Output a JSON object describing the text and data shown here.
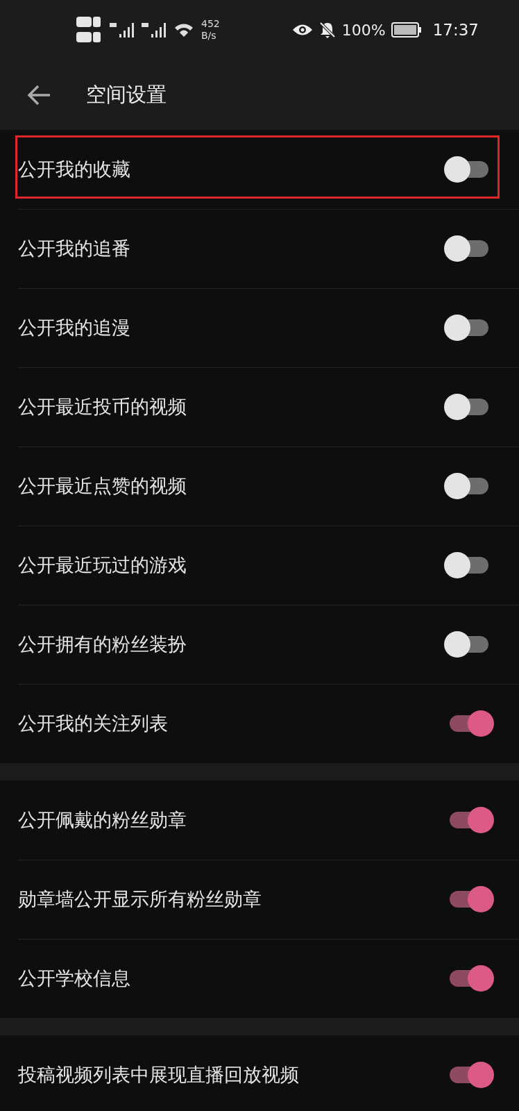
{
  "status_bar": {
    "network_speed": "452",
    "network_speed_unit": "B/s",
    "battery": "100%",
    "time": "17:37"
  },
  "header": {
    "title": "空间设置"
  },
  "sections": [
    {
      "items": [
        {
          "label": "公开我的收藏",
          "on": false,
          "highlighted": true
        },
        {
          "label": "公开我的追番",
          "on": false,
          "highlighted": false
        },
        {
          "label": "公开我的追漫",
          "on": false,
          "highlighted": false
        },
        {
          "label": "公开最近投币的视频",
          "on": false,
          "highlighted": false
        },
        {
          "label": "公开最近点赞的视频",
          "on": false,
          "highlighted": false
        },
        {
          "label": "公开最近玩过的游戏",
          "on": false,
          "highlighted": false
        },
        {
          "label": "公开拥有的粉丝装扮",
          "on": false,
          "highlighted": false
        },
        {
          "label": "公开我的关注列表",
          "on": true,
          "highlighted": false
        }
      ]
    },
    {
      "items": [
        {
          "label": "公开佩戴的粉丝勋章",
          "on": true,
          "highlighted": false
        },
        {
          "label": "勋章墙公开显示所有粉丝勋章",
          "on": true,
          "highlighted": false
        },
        {
          "label": "公开学校信息",
          "on": true,
          "highlighted": false
        }
      ]
    },
    {
      "items": [
        {
          "label": "投稿视频列表中展现直播回放视频",
          "on": true,
          "highlighted": false
        }
      ]
    }
  ]
}
